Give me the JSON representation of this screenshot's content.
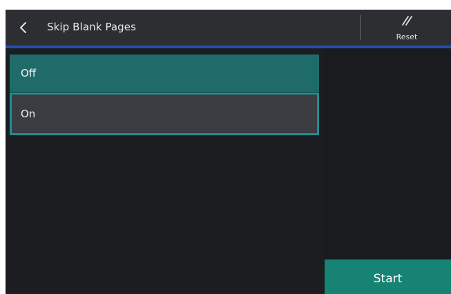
{
  "header": {
    "title": "Skip Blank Pages",
    "reset_label": "Reset"
  },
  "options": [
    {
      "label": "Off",
      "state": "highlighted"
    },
    {
      "label": "On",
      "state": "focused"
    }
  ],
  "actions": {
    "start_label": "Start"
  },
  "colors": {
    "header_bg": "#2d2e32",
    "header_accent": "#1f4fb0",
    "body_bg": "#1c1d20",
    "option_off_bg": "#1f6b6a",
    "option_on_bg": "#3a3c41",
    "focus_border": "#1f8f92",
    "start_bg": "#168374"
  }
}
